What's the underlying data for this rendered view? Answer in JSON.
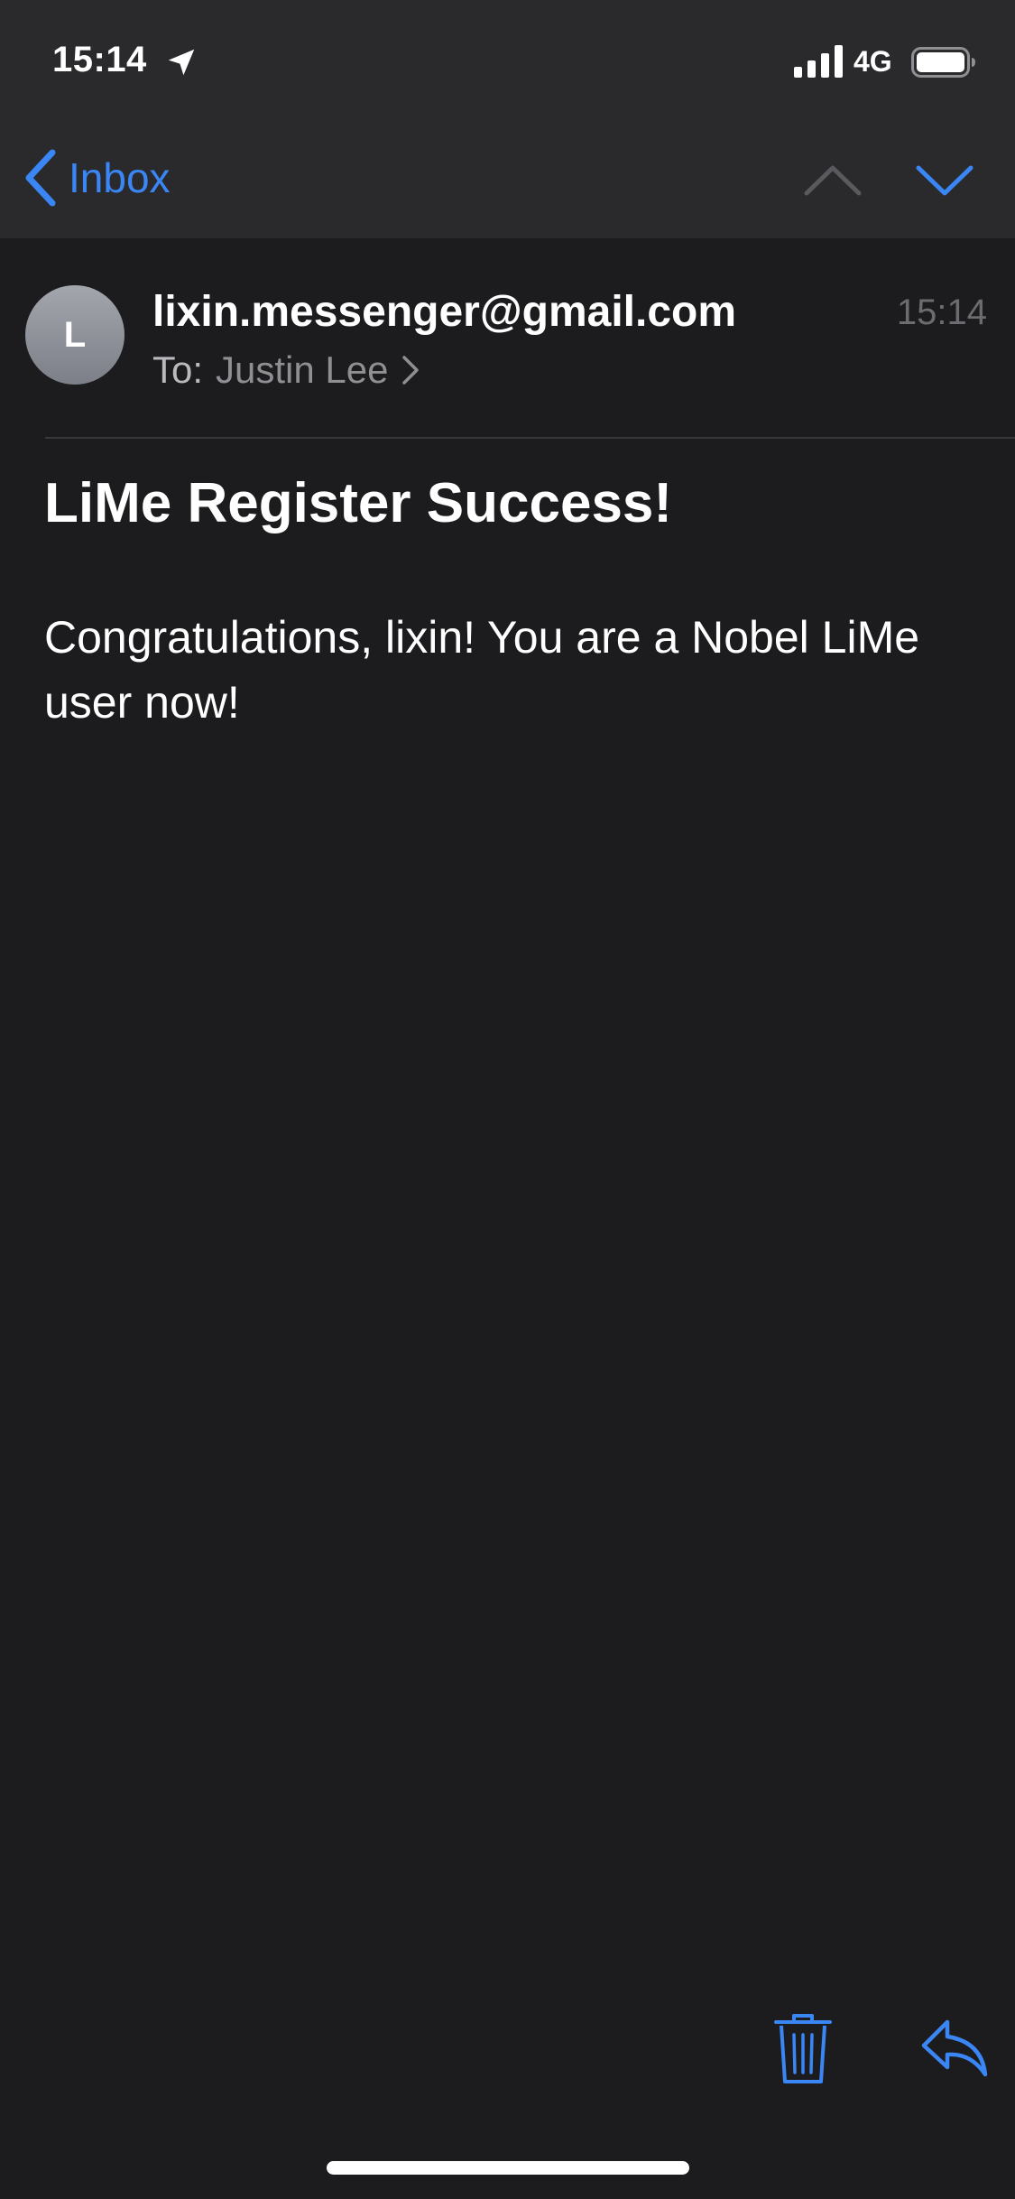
{
  "status_bar": {
    "time": "15:14",
    "network": "4G",
    "icons": [
      "location-arrow-icon",
      "signal-icon",
      "battery-icon"
    ]
  },
  "nav": {
    "back_label": "Inbox",
    "icons": [
      "chevron-left-icon",
      "chevron-up-icon",
      "chevron-down-icon"
    ]
  },
  "message": {
    "avatar_initial": "L",
    "sender": "lixin.messenger@gmail.com",
    "time": "15:14",
    "to_label": "To:",
    "recipient": "Justin Lee",
    "subject": "LiMe Register Success!",
    "body": "Congratulations, lixin! You are a Nobel LiMe user now!"
  },
  "toolbar": {
    "icons": [
      "trash-icon",
      "reply-icon"
    ]
  },
  "colors": {
    "accent": "#3a86f5",
    "background": "#1c1c1e",
    "top_bar": "#2a2a2c",
    "secondary_text": "#8e8e93",
    "disabled": "#5a5a5e"
  }
}
